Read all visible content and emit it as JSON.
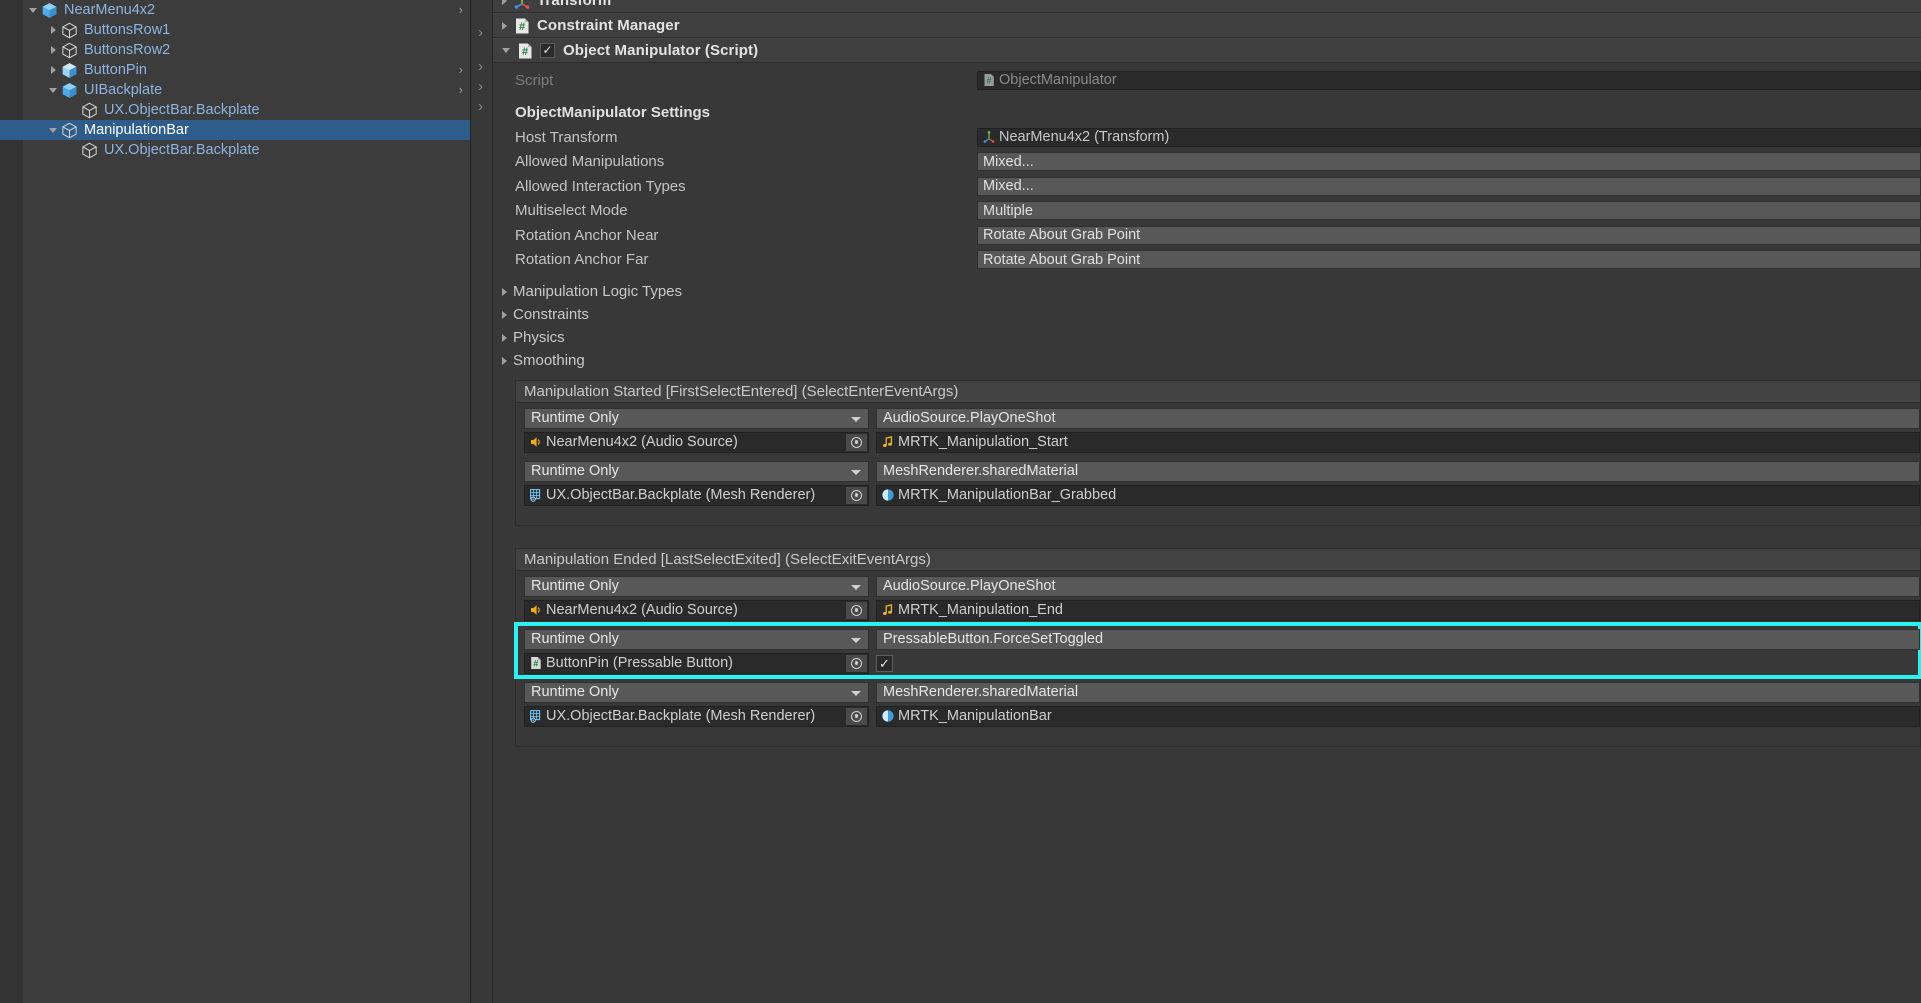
{
  "theme": {
    "panel_bg": "#383838",
    "hierarchy_bg": "#3c3c3c",
    "selection_blue": "#2f5d8b",
    "link_blue": "#8db4e2",
    "highlight_cyan": "#2ff0f0",
    "field_dark": "#2a2a2a",
    "field_light": "#585858"
  },
  "hierarchy": {
    "items": [
      {
        "label": "NearMenu4x2",
        "indent": 0,
        "foldout": "open",
        "icon": "prefab-cube-icon",
        "selected": false,
        "expand_arrow": true
      },
      {
        "label": "ButtonsRow1",
        "indent": 1,
        "foldout": "closed",
        "icon": "gameobject-cube-icon",
        "selected": false,
        "expand_arrow": false
      },
      {
        "label": "ButtonsRow2",
        "indent": 1,
        "foldout": "closed",
        "icon": "gameobject-cube-icon",
        "selected": false,
        "expand_arrow": false
      },
      {
        "label": "ButtonPin",
        "indent": 1,
        "foldout": "closed",
        "icon": "prefab-variant-cube-icon",
        "selected": false,
        "expand_arrow": true
      },
      {
        "label": "UIBackplate",
        "indent": 1,
        "foldout": "open",
        "icon": "prefab-cube-icon",
        "selected": false,
        "expand_arrow": true
      },
      {
        "label": "UX.ObjectBar.Backplate",
        "indent": 2,
        "foldout": "none",
        "icon": "gameobject-cube-icon",
        "selected": false,
        "expand_arrow": false
      },
      {
        "label": "ManipulationBar",
        "indent": 1,
        "foldout": "open",
        "icon": "gameobject-cube-icon",
        "selected": true,
        "expand_arrow": false
      },
      {
        "label": "UX.ObjectBar.Backplate",
        "indent": 2,
        "foldout": "none",
        "icon": "gameobject-cube-icon",
        "selected": false,
        "expand_arrow": false
      }
    ]
  },
  "inspector": {
    "components": [
      {
        "title": "Transform",
        "icon": "transform-icon",
        "foldout": "closed",
        "has_enable_checkbox": false
      },
      {
        "title": "Constraint Manager",
        "icon": "script-icon",
        "foldout": "closed",
        "has_enable_checkbox": false
      },
      {
        "title": "Object Manipulator (Script)",
        "icon": "script-icon",
        "foldout": "open",
        "has_enable_checkbox": true,
        "enabled": true
      }
    ],
    "script_row": {
      "label": "Script",
      "value": "ObjectManipulator",
      "icon": "script-icon"
    },
    "settings_header": "ObjectManipulator Settings",
    "properties": [
      {
        "label": "Host Transform",
        "value": "NearMenu4x2 (Transform)",
        "field": "object",
        "icon": "transform-icon"
      },
      {
        "label": "Allowed Manipulations",
        "value": "Mixed...",
        "field": "enum",
        "icon": ""
      },
      {
        "label": "Allowed Interaction Types",
        "value": "Mixed...",
        "field": "enum",
        "icon": ""
      },
      {
        "label": "Multiselect Mode",
        "value": "Multiple",
        "field": "enum",
        "icon": ""
      },
      {
        "label": "Rotation Anchor Near",
        "value": "Rotate About Grab Point",
        "field": "enum",
        "icon": ""
      },
      {
        "label": "Rotation Anchor Far",
        "value": "Rotate About Grab Point",
        "field": "enum",
        "icon": ""
      }
    ],
    "foldouts": [
      {
        "label": "Manipulation Logic Types"
      },
      {
        "label": "Constraints"
      },
      {
        "label": "Physics"
      },
      {
        "label": "Smoothing"
      }
    ],
    "events": [
      {
        "title": "Manipulation Started [FirstSelectEntered] (SelectEnterEventArgs)",
        "entries": [
          {
            "call_state": "Runtime Only",
            "target": "NearMenu4x2 (Audio Source)",
            "target_icon": "audiosource-icon",
            "method": "AudioSource.PlayOneShot",
            "argument": "MRTK_Manipulation_Start",
            "argument_icon": "audioclip-icon",
            "argument_type": "object",
            "highlighted": false
          },
          {
            "call_state": "Runtime Only",
            "target": "UX.ObjectBar.Backplate (Mesh Renderer)",
            "target_icon": "meshrenderer-icon",
            "method": "MeshRenderer.sharedMaterial",
            "argument": "MRTK_ManipulationBar_Grabbed",
            "argument_icon": "material-icon",
            "argument_type": "object",
            "highlighted": false
          }
        ]
      },
      {
        "title": "Manipulation Ended [LastSelectExited] (SelectExitEventArgs)",
        "entries": [
          {
            "call_state": "Runtime Only",
            "target": "NearMenu4x2 (Audio Source)",
            "target_icon": "audiosource-icon",
            "method": "AudioSource.PlayOneShot",
            "argument": "MRTK_Manipulation_End",
            "argument_icon": "audioclip-icon",
            "argument_type": "object",
            "highlighted": false
          },
          {
            "call_state": "Runtime Only",
            "target": "ButtonPin (Pressable Button)",
            "target_icon": "script-icon",
            "method": "PressableButton.ForceSetToggled",
            "argument": "",
            "argument_icon": "",
            "argument_type": "checkbox",
            "argument_checked": true,
            "highlighted": true
          },
          {
            "call_state": "Runtime Only",
            "target": "UX.ObjectBar.Backplate (Mesh Renderer)",
            "target_icon": "meshrenderer-icon",
            "method": "MeshRenderer.sharedMaterial",
            "argument": "MRTK_ManipulationBar",
            "argument_icon": "material-icon",
            "argument_type": "object",
            "highlighted": false
          }
        ]
      }
    ]
  }
}
